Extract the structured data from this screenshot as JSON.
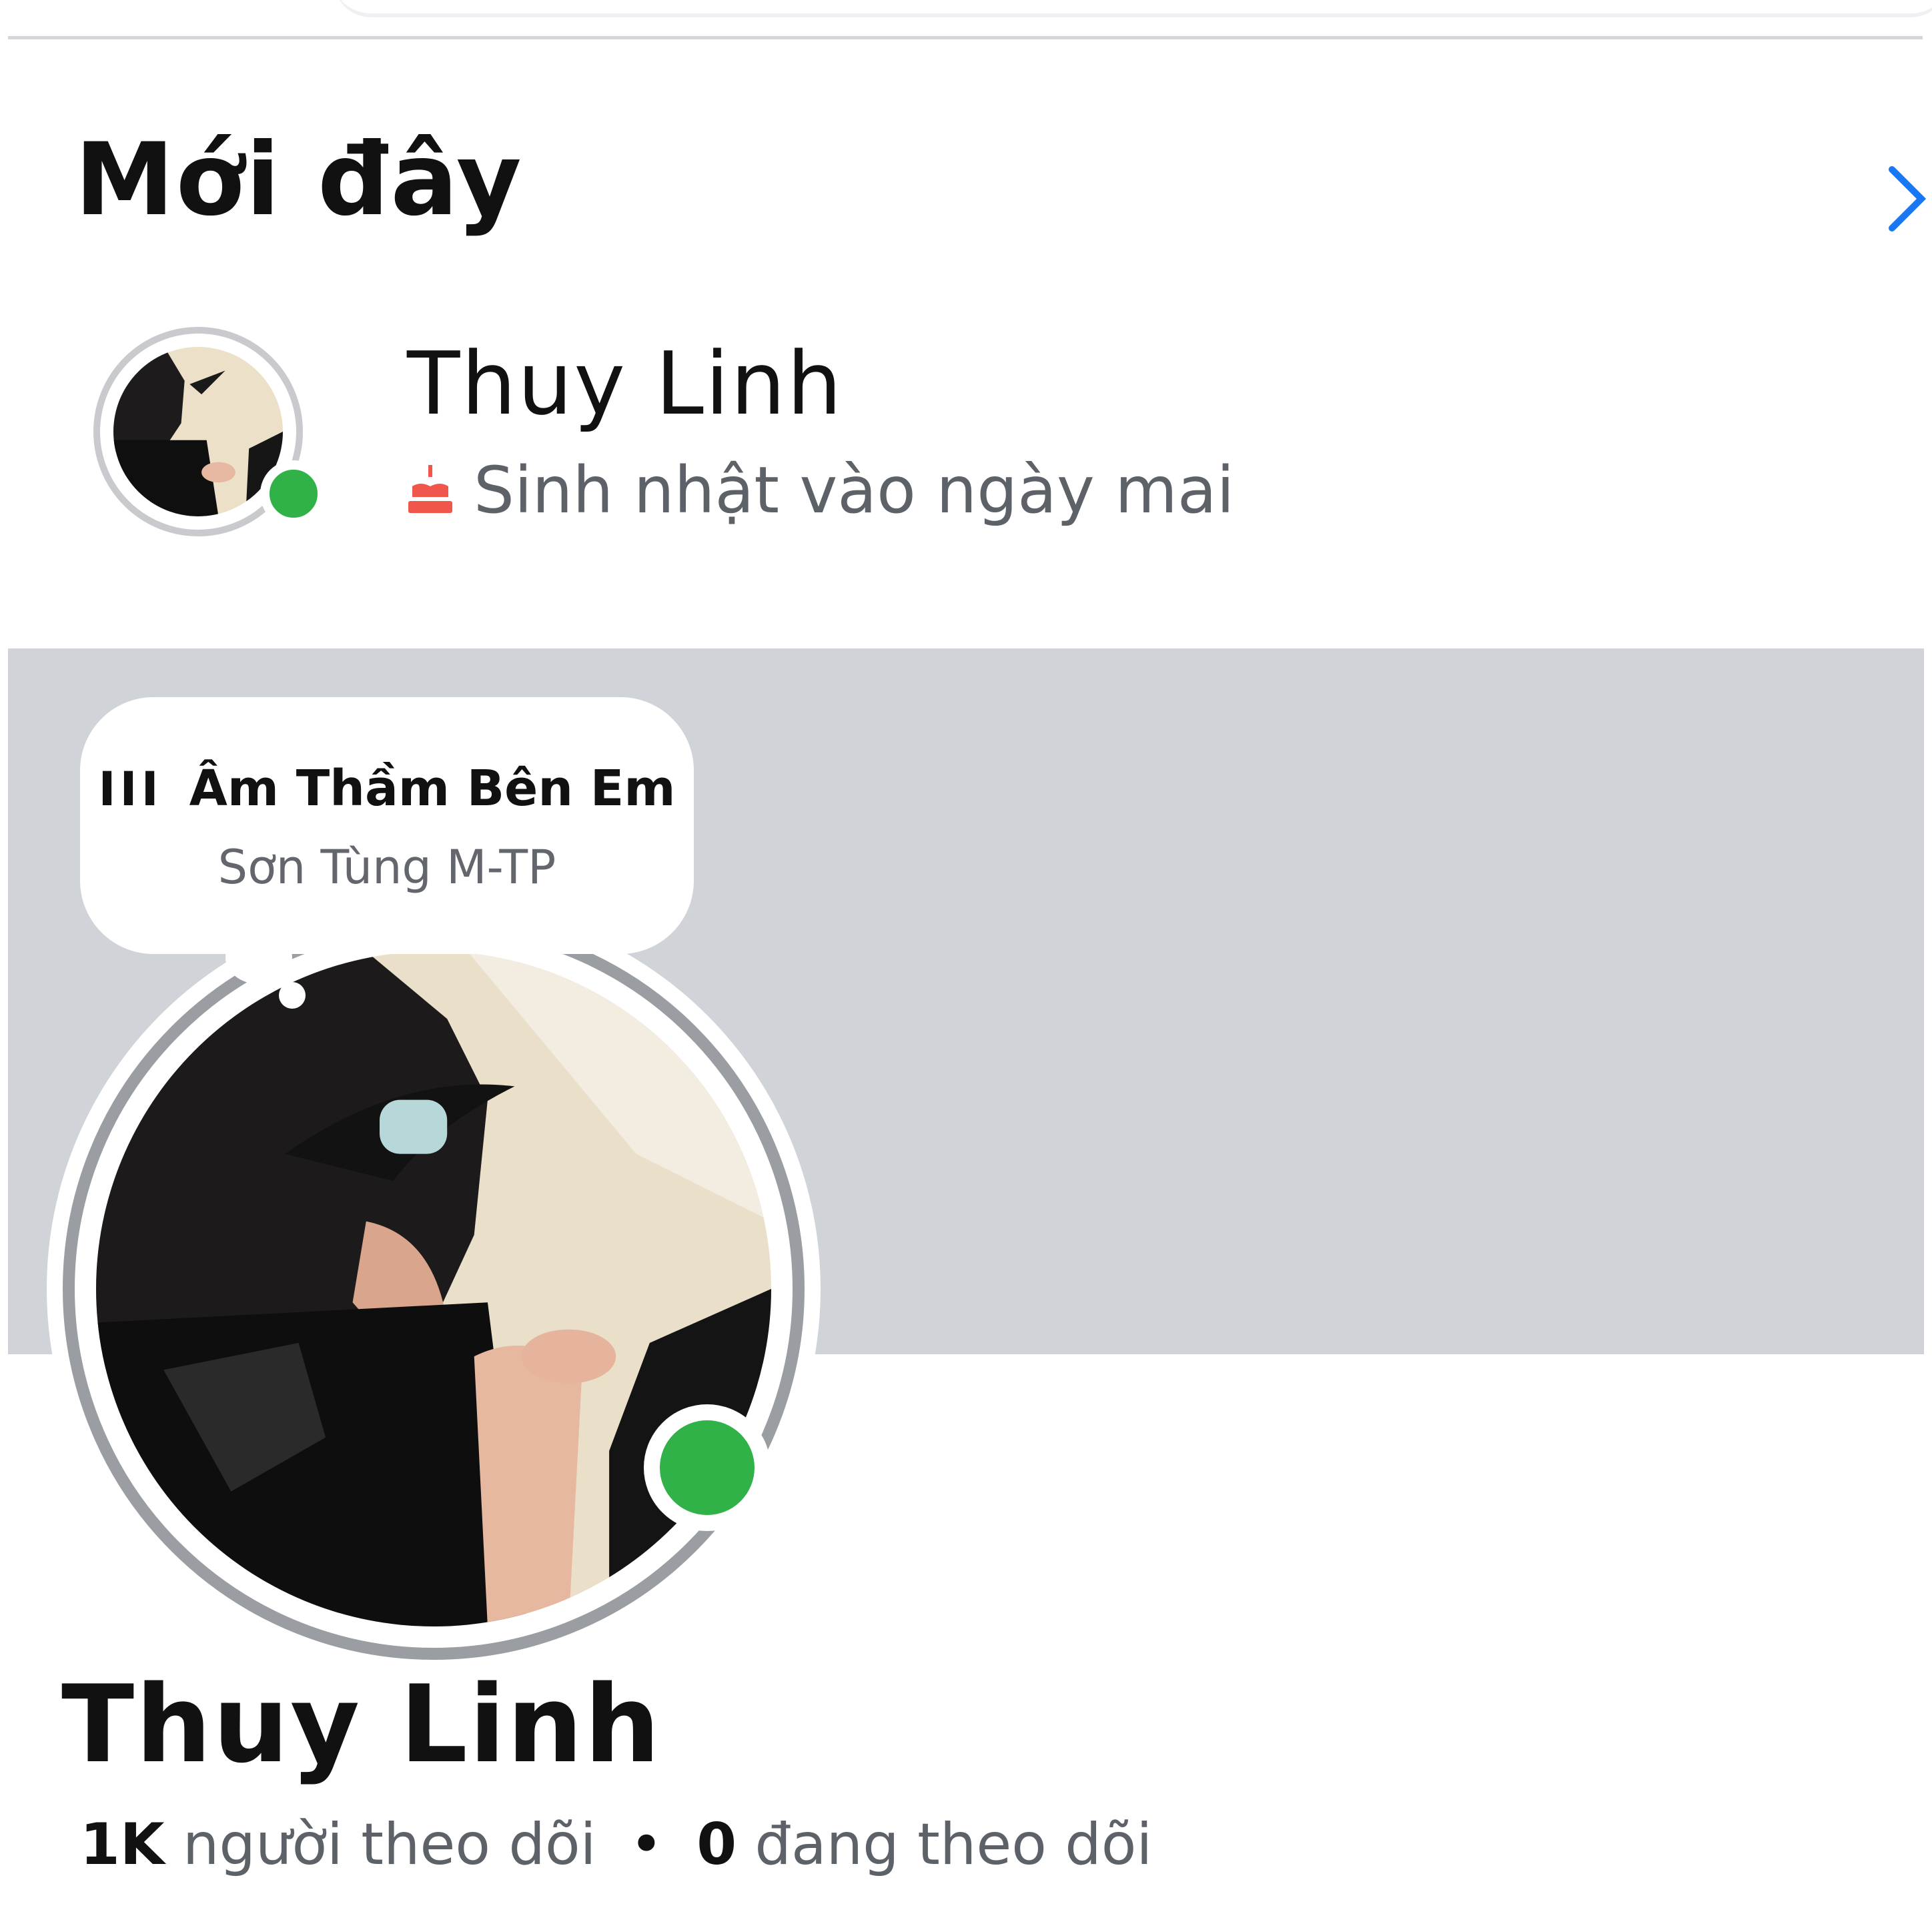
{
  "section": {
    "title": "Mới đây",
    "see_all_icon": "chevron-right-icon"
  },
  "recent_friend": {
    "name": "Thuy Linh",
    "birthday_icon": "cake-icon",
    "status": "Sinh nhật vào ngày mai",
    "online": true
  },
  "note": {
    "icon": "music-bars-icon",
    "bars": "III",
    "song": "Âm Thầm Bên Em",
    "artist": "Sơn Tùng M-TP"
  },
  "profile": {
    "name": "Thuy Linh",
    "online": true,
    "followers_count": "1K",
    "followers_label": "người theo dõi",
    "separator": "•",
    "following_count": "0",
    "following_label": "đang theo dõi"
  },
  "colors": {
    "accent": "#1877f2",
    "online": "#31b249",
    "cover": "#d0d3d8",
    "cake": "#f0564b"
  }
}
